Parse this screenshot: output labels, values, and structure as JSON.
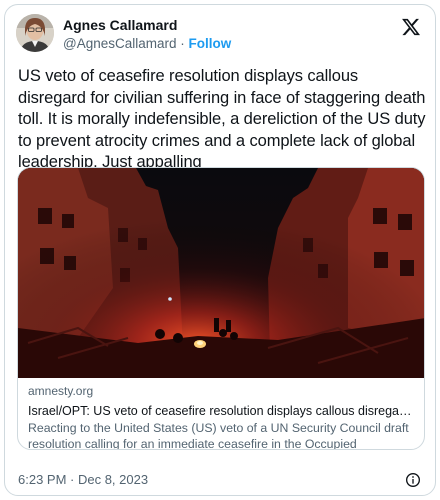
{
  "author": {
    "name": "Agnes Callamard",
    "handle": "@AgnesCallamard",
    "separator": "·",
    "follow_label": "Follow"
  },
  "header": {
    "logo_icon": "x-logo-icon"
  },
  "tweet": {
    "text": "US veto of ceasefire resolution displays callous disregard for civilian suffering in face of staggering death toll. It is morally indefensible, a dereliction of the US duty to prevent atrocity crimes and a complete lack of global leadership. Just appalling"
  },
  "link_card": {
    "domain": "amnesty.org",
    "title": "Israel/OPT: US veto of ceasefire resolution displays callous disregard for ...",
    "description_line1": "Reacting to the United States (US) veto of a UN Security Council draft",
    "description_line2": "resolution calling for an immediate ceasefire in the Occupied Palestinian..."
  },
  "footer": {
    "timestamp": "6:23 PM · Dec 8, 2023",
    "info_icon": "info-icon"
  },
  "colors": {
    "follow": "#1d9bf0",
    "secondary_text": "#536471",
    "border": "#cfd9de"
  }
}
